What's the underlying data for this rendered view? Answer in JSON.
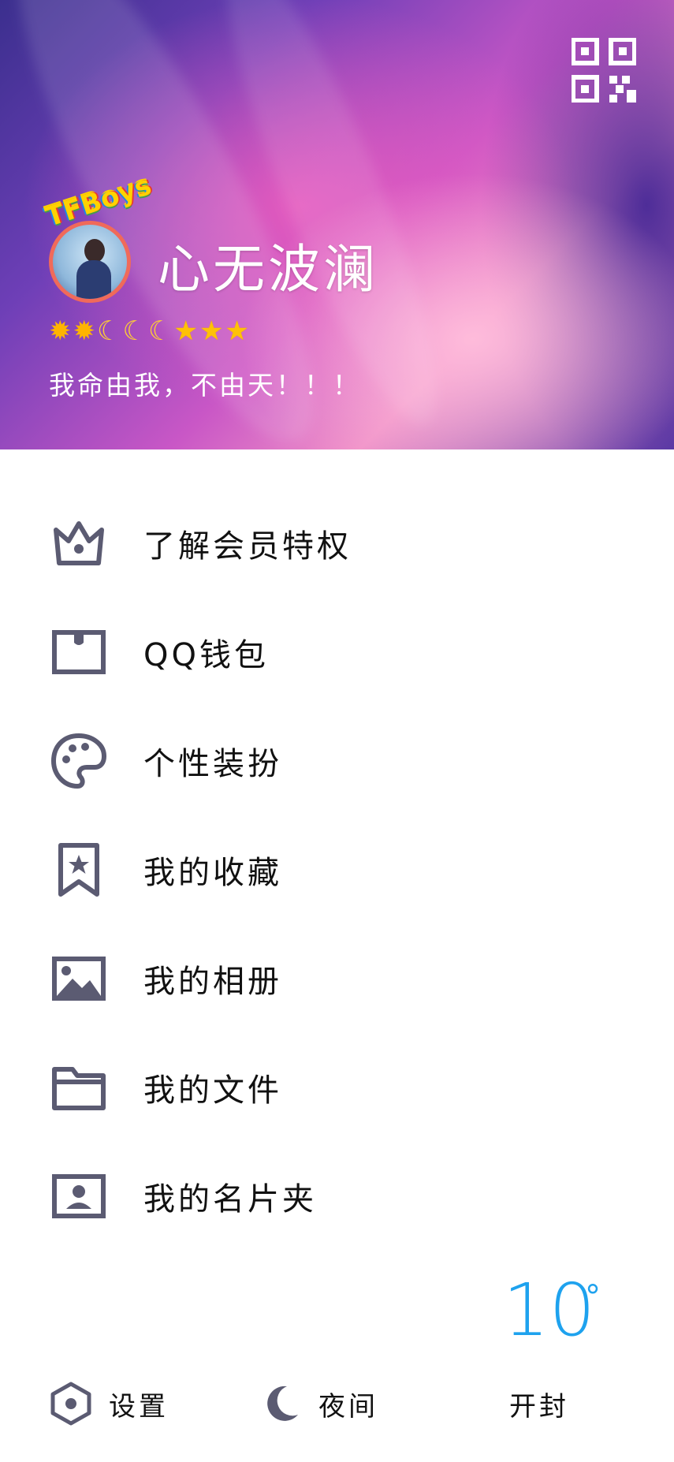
{
  "profile": {
    "nickname": "心无波澜",
    "badge_text": "TFBoys",
    "signature": "我命由我，不由天！！！",
    "level_icons": [
      "sun-icon",
      "sun-icon",
      "moon-icon",
      "moon-icon",
      "moon-icon",
      "star-icon",
      "star-icon",
      "star-icon"
    ]
  },
  "header": {
    "qr_icon": "qr-code-icon"
  },
  "menu": [
    {
      "label": "了解会员特权",
      "icon": "crown-icon"
    },
    {
      "label": "QQ钱包",
      "icon": "wallet-icon"
    },
    {
      "label": "个性装扮",
      "icon": "palette-icon"
    },
    {
      "label": "我的收藏",
      "icon": "bookmark-star-icon"
    },
    {
      "label": "我的相册",
      "icon": "image-icon"
    },
    {
      "label": "我的文件",
      "icon": "folder-icon"
    },
    {
      "label": "我的名片夹",
      "icon": "contact-card-icon"
    }
  ],
  "bottom": {
    "settings_label": "设置",
    "night_label": "夜间",
    "weather": {
      "temperature": "10",
      "degree_symbol": "°",
      "city": "开封"
    }
  },
  "colors": {
    "icon": "#5b5b72",
    "weather": "#1ea2ee",
    "avatar_border": "#f06a5a"
  }
}
